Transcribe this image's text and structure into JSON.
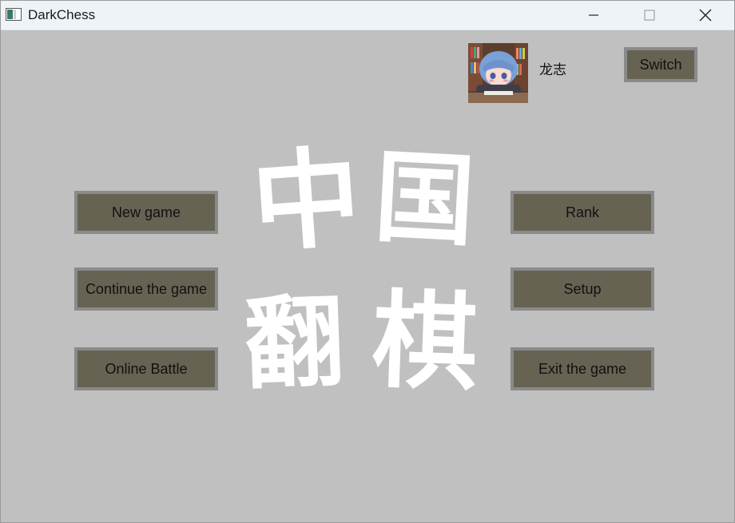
{
  "window": {
    "title": "DarkChess"
  },
  "user": {
    "name": "龙志",
    "switch_label": "Switch"
  },
  "menu": {
    "new_game": "New game",
    "continue_game": "Continue the game",
    "online_battle": "Online Battle",
    "rank": "Rank",
    "setup": "Setup",
    "exit_game": "Exit the game"
  },
  "logo": {
    "char1": "中",
    "char2": "国",
    "char3": "翻",
    "char4": "棋"
  },
  "colors": {
    "background": "#c0c0c0",
    "button_fill": "#666353",
    "button_border": "#8a8a8a",
    "logo_text": "#ffffff"
  }
}
